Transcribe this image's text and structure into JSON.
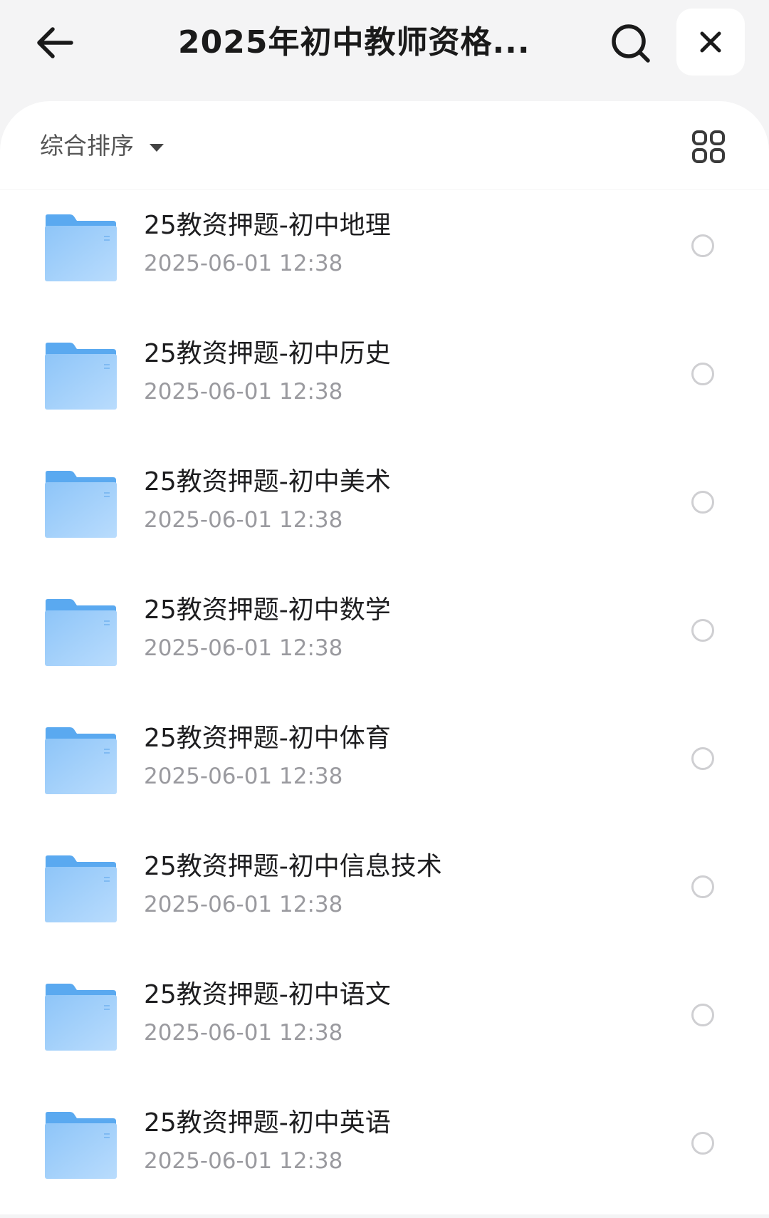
{
  "header": {
    "title": "2025年初中教师资格...",
    "back_icon": "arrow-left-icon",
    "search_icon": "search-icon",
    "close_icon": "close-icon"
  },
  "toolbar": {
    "sort_label": "综合排序",
    "sort_icon": "caret-down-icon",
    "view_icon": "grid-view-icon"
  },
  "colors": {
    "background": "#f4f4f5",
    "panel": "#ffffff",
    "folder_light": "#a8d3fb",
    "folder_dark": "#5aa9f0",
    "date_text": "#9a9a9f"
  },
  "files": [
    {
      "name": "25教资押题-初中地理",
      "date": "2025-06-01 12:38",
      "icon": "folder-icon"
    },
    {
      "name": "25教资押题-初中历史",
      "date": "2025-06-01 12:38",
      "icon": "folder-icon"
    },
    {
      "name": "25教资押题-初中美术",
      "date": "2025-06-01 12:38",
      "icon": "folder-icon"
    },
    {
      "name": "25教资押题-初中数学",
      "date": "2025-06-01 12:38",
      "icon": "folder-icon"
    },
    {
      "name": "25教资押题-初中体育",
      "date": "2025-06-01 12:38",
      "icon": "folder-icon"
    },
    {
      "name": "25教资押题-初中信息技术",
      "date": "2025-06-01 12:38",
      "icon": "folder-icon"
    },
    {
      "name": "25教资押题-初中语文",
      "date": "2025-06-01 12:38",
      "icon": "folder-icon"
    },
    {
      "name": "25教资押题-初中英语",
      "date": "2025-06-01 12:38",
      "icon": "folder-icon"
    }
  ]
}
